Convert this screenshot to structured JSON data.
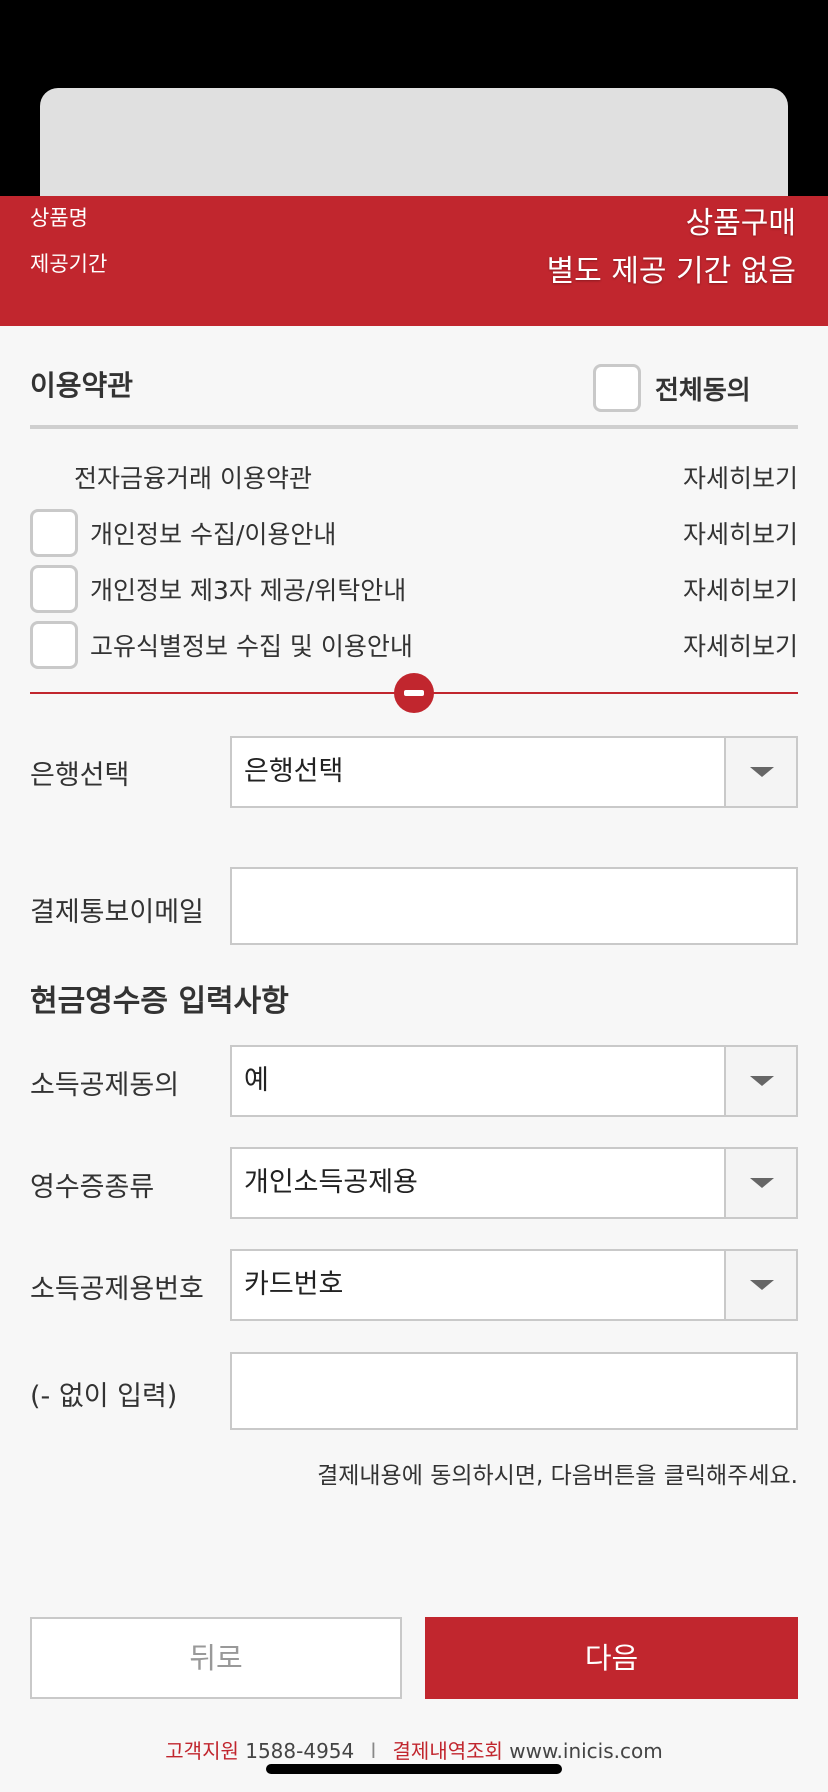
{
  "product": {
    "name_label": "상품명",
    "name_value": "상품구매",
    "period_label": "제공기간",
    "period_value": "별도 제공 기간 없음"
  },
  "terms": {
    "title": "이용약관",
    "agree_all_label": "전체동의",
    "items": [
      {
        "label": "전자금융거래 이용약관",
        "more": "자세히보기",
        "has_checkbox": false
      },
      {
        "label": "개인정보 수집/이용안내",
        "more": "자세히보기",
        "has_checkbox": true
      },
      {
        "label": "개인정보 제3자 제공/위탁안내",
        "more": "자세히보기",
        "has_checkbox": true
      },
      {
        "label": "고유식별정보 수집 및 이용안내",
        "more": "자세히보기",
        "has_checkbox": true
      }
    ]
  },
  "form": {
    "bank_label": "은행선택",
    "bank_value": "은행선택",
    "email_label": "결제통보이메일",
    "email_value": ""
  },
  "cash_receipt": {
    "title": "현금영수증 입력사항",
    "consent_label": "소득공제동의",
    "consent_value": "예",
    "type_label": "영수증종류",
    "type_value": "개인소득공제용",
    "number_type_label": "소득공제용번호",
    "number_type_value": "카드번호",
    "number_label": "(- 없이 입력)",
    "number_value": ""
  },
  "notice": "결제내용에 동의하시면, 다음버튼을 클릭해주세요.",
  "buttons": {
    "back": "뒤로",
    "next": "다음"
  },
  "footer": {
    "support_label": "고객지원",
    "phone": "1588-4954",
    "separator": "l",
    "history_label": "결제내역조회",
    "site": "www.inicis.com"
  },
  "colors": {
    "brand_red": "#c1262e",
    "border_grey": "#c9c9c9"
  }
}
